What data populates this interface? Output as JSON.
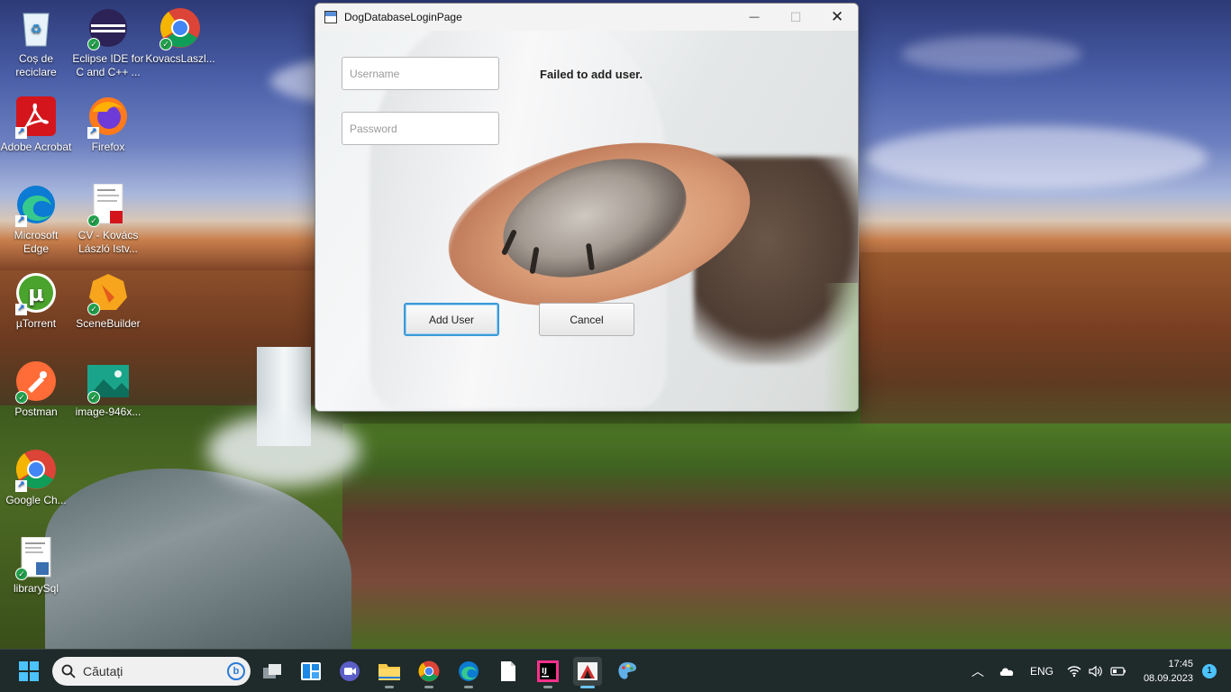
{
  "desktop": {
    "icons": [
      {
        "label": "Coș de reciclare",
        "icon": "recycle-bin-icon"
      },
      {
        "label": "Eclipse IDE for C and C++ ...",
        "icon": "eclipse-icon"
      },
      {
        "label": "KovacsLaszl...",
        "icon": "chrome-icon"
      },
      {
        "label": "Adobe Acrobat",
        "icon": "acrobat-icon"
      },
      {
        "label": "Firefox",
        "icon": "firefox-icon"
      },
      {
        "label": "Microsoft Edge",
        "icon": "edge-icon"
      },
      {
        "label": "CV - Kovács László Istv...",
        "icon": "pdf-document-icon"
      },
      {
        "label": "µTorrent",
        "icon": "utorrent-icon"
      },
      {
        "label": "SceneBuilder",
        "icon": "scenebuilder-icon"
      },
      {
        "label": "Postman",
        "icon": "postman-icon"
      },
      {
        "label": "image-946x...",
        "icon": "image-file-icon"
      },
      {
        "label": "Google Ch...",
        "icon": "chrome-icon"
      },
      {
        "label": "librarySql",
        "icon": "sql-file-icon"
      }
    ]
  },
  "window": {
    "title": "DogDatabaseLoginPage",
    "controls": {
      "minimize": "—",
      "maximize": "☐",
      "close": "✕"
    },
    "username_placeholder": "Username",
    "password_placeholder": "Password",
    "status_message": "Failed to add user.",
    "add_user_label": "Add User",
    "cancel_label": "Cancel"
  },
  "taskbar": {
    "search_placeholder": "Căutați",
    "language": "ENG",
    "time": "17:45",
    "date": "08.09.2023",
    "notification_count": "1",
    "apps": [
      "start-icon",
      "task-view-icon",
      "widgets-icon",
      "teams-meet-icon",
      "file-explorer-icon",
      "chrome-icon",
      "edge-icon",
      "notepad-icon",
      "intellij-icon",
      "java-app-icon",
      "paint-icon"
    ]
  },
  "colors": {
    "accent": "#3a9ad9",
    "taskbar_bg": "#1f2a2a"
  }
}
